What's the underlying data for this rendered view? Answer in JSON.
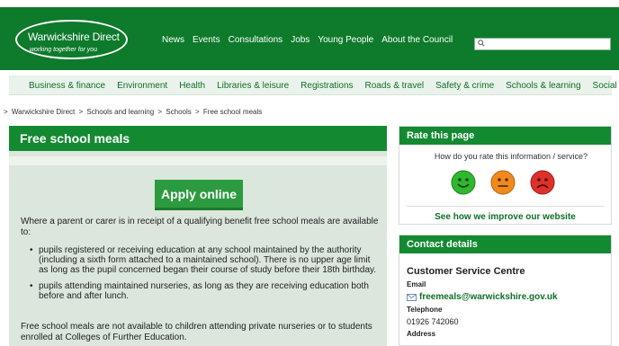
{
  "header": {
    "logo_title": "Warwickshire Direct",
    "logo_tagline": "working together for you",
    "nav": [
      "News",
      "Events",
      "Consultations",
      "Jobs",
      "Young People",
      "About the Council"
    ],
    "search_placeholder": ""
  },
  "subnav": [
    "Business & finance",
    "Environment",
    "Health",
    "Libraries & leisure",
    "Registrations",
    "Roads & travel",
    "Safety & crime",
    "Schools & learning",
    "Social care"
  ],
  "breadcrumb": [
    "Warwickshire Direct",
    "Schools and learning",
    "Schools",
    "Free school meals"
  ],
  "main": {
    "title": "Free school meals",
    "apply_label": "Apply online",
    "intro": "Where a parent or carer is in receipt of a qualifying benefit free school meals are available to:",
    "bullets": [
      "pupils registered or receiving education at any school maintained by the authority (including a sixth form attached to a maintained school). There is no upper age limit as long as the pupil concerned began their course of study before their 18th birthday.",
      "pupils attending maintained nurseries, as long as they are receiving education both before and after lunch."
    ],
    "outro": "Free school meals are not available to children attending private nurseries or to students enrolled at Colleges of Further Education."
  },
  "rate": {
    "title": "Rate this page",
    "question": "How do you rate this information / service?",
    "faces": [
      "happy-face-icon",
      "neutral-face-icon",
      "sad-face-icon"
    ],
    "face_colors": [
      "#2eb82e",
      "#f08a1c",
      "#e0302a"
    ],
    "link": "See how we improve our website"
  },
  "contact": {
    "title": "Contact details",
    "name": "Customer Service Centre",
    "email_label": "Email",
    "email": "freemeals@warwickshire.gov.uk",
    "phone_label": "Telephone",
    "phone": "01926 742060",
    "address_label": "Address"
  },
  "colors": {
    "header_green": "#0e7a2b",
    "panel_green": "#138a31",
    "link_green": "#0e6f26"
  }
}
